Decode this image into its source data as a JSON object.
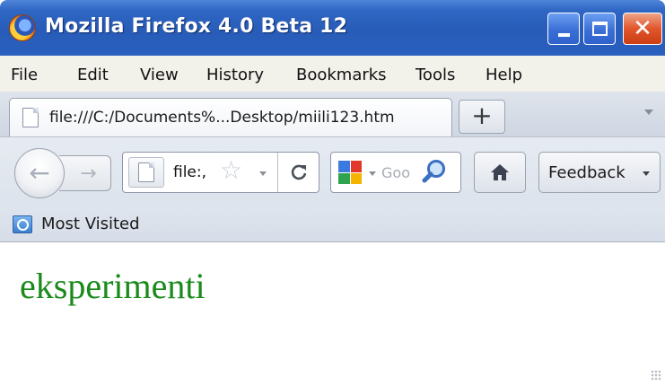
{
  "window": {
    "title": "Mozilla Firefox 4.0 Beta 12",
    "close_glyph": "✕"
  },
  "menu": [
    "File",
    "Edit",
    "View",
    "History",
    "Bookmarks",
    "Tools",
    "Help"
  ],
  "tab": {
    "label": "file:///C:/Documents%...Desktop/miili123.htm",
    "new_tab_label": "+"
  },
  "navbar": {
    "back_glyph": "←",
    "forward_glyph": "→",
    "url_text": "file:,",
    "star_glyph": "☆",
    "reload_glyph": "C",
    "search_placeholder": "Goo",
    "feedback_label": "Feedback"
  },
  "bookmarks": {
    "most_visited": "Most Visited"
  },
  "content": {
    "heading": "eksperimenti",
    "heading_color": "#1a8a1a"
  },
  "colors": {
    "titlebar": "#2f67c4",
    "close_button": "#e1562c"
  },
  "icons": [
    "firefox-logo-icon",
    "minimize-icon",
    "maximize-icon",
    "close-icon",
    "document-icon",
    "plus-icon",
    "back-arrow-icon",
    "forward-arrow-icon",
    "star-icon",
    "reload-icon",
    "google-icon",
    "magnifier-icon",
    "home-icon",
    "most-visited-icon",
    "resize-grip-icon"
  ]
}
